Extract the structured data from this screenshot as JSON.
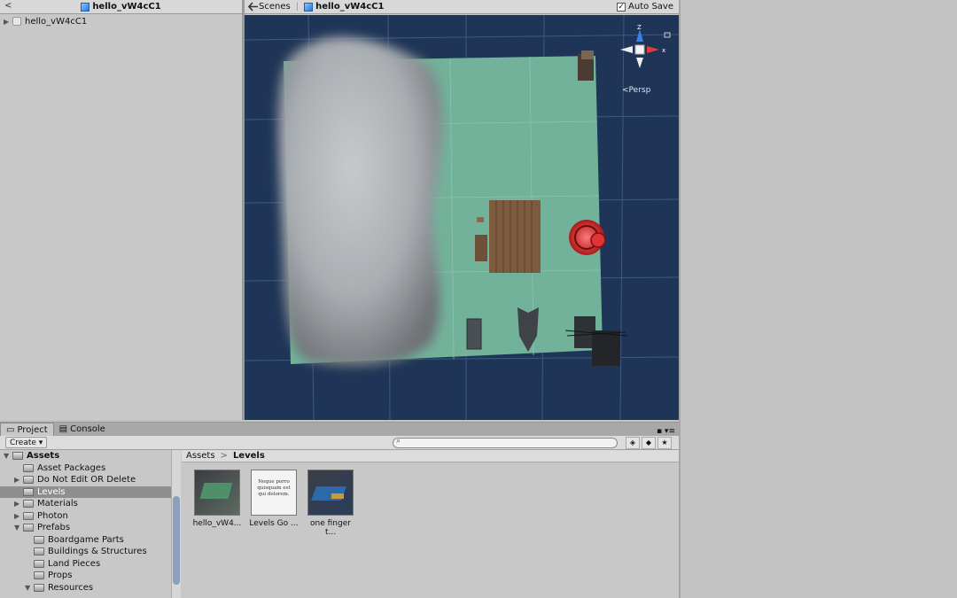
{
  "hierarchy": {
    "back": "<",
    "title": "hello_vW4cC1",
    "items": [
      {
        "label": "hello_vW4cC1"
      }
    ]
  },
  "scene": {
    "tab_scenes": "Scenes",
    "tab_current": "hello_vW4cC1",
    "auto_save": "Auto Save",
    "auto_save_checked": "✓",
    "gizmo_axis_z": "Z",
    "gizmo_axis_x": "x",
    "projection": "Persp"
  },
  "project": {
    "tab_project": "Project",
    "tab_console": "Console",
    "create": "Create ▾",
    "tree": [
      {
        "label": "Assets",
        "indent": 0,
        "arrow": "▼",
        "bold": true
      },
      {
        "label": "Asset Packages",
        "indent": 1,
        "arrow": ""
      },
      {
        "label": "Do Not Edit OR Delete",
        "indent": 1,
        "arrow": "▶"
      },
      {
        "label": "Levels",
        "indent": 1,
        "arrow": "",
        "selected": true
      },
      {
        "label": "Materials",
        "indent": 1,
        "arrow": "▶"
      },
      {
        "label": "Photon",
        "indent": 1,
        "arrow": "▶"
      },
      {
        "label": "Prefabs",
        "indent": 1,
        "arrow": "▼"
      },
      {
        "label": "Boardgame Parts",
        "indent": 2,
        "arrow": ""
      },
      {
        "label": "Buildings & Structures",
        "indent": 2,
        "arrow": ""
      },
      {
        "label": "Land Pieces",
        "indent": 2,
        "arrow": ""
      },
      {
        "label": "Props",
        "indent": 2,
        "arrow": ""
      },
      {
        "label": "Resources",
        "indent": 2,
        "arrow": "▼"
      }
    ],
    "breadcrumb": {
      "root": "Assets",
      "sep": ">",
      "current": "Levels"
    },
    "files": [
      {
        "label": "hello_vW4..."
      },
      {
        "label": "Levels Go ..."
      },
      {
        "label": "one finger t..."
      }
    ],
    "doc_thumb_text": "Neque porro quisquam est qui dolorem."
  },
  "colors": {
    "viewport_bg": "#1e3557",
    "ground": "#72b29a",
    "selection": "#8e8e8e"
  }
}
